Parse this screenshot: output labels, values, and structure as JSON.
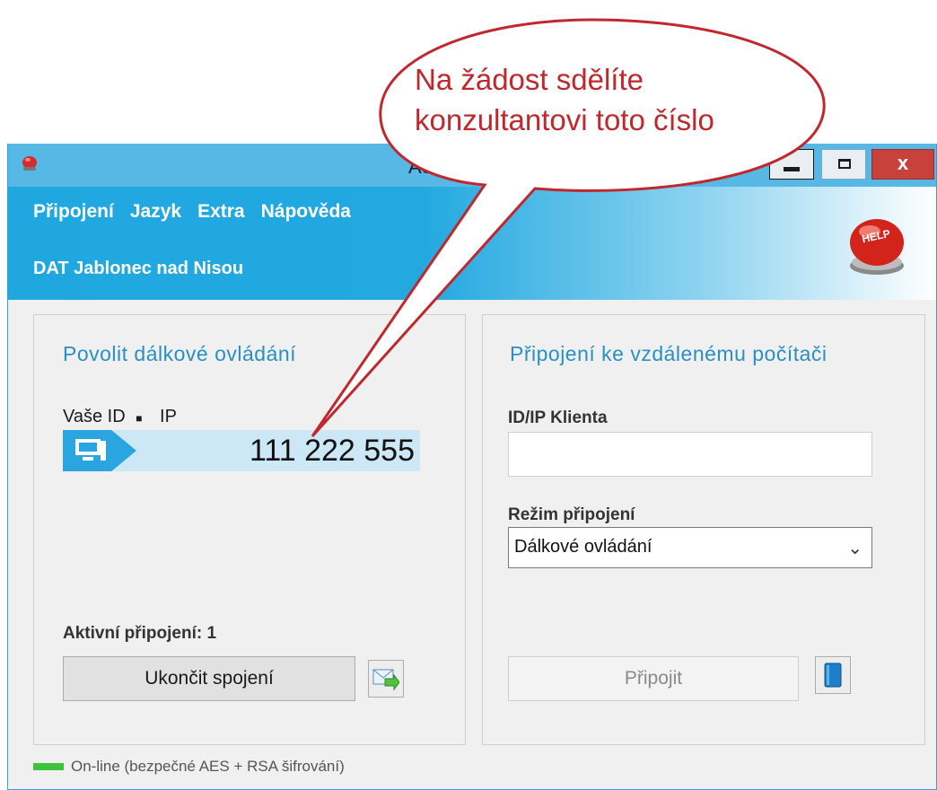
{
  "window": {
    "title": "Aero"
  },
  "titlebar": {
    "close_label": "x"
  },
  "menu": {
    "items": [
      "Připojení",
      "Jazyk",
      "Extra",
      "Nápověda"
    ]
  },
  "organization": "DAT Jablonec nad Nisou",
  "help_badge": "HELP",
  "left_panel": {
    "title": "Povolit dálkové ovládání",
    "id_label": "Vaše ID",
    "ip_label": "IP",
    "id_value": "111 222 555",
    "active_connections": "Aktivní připojení: 1",
    "end_button": "Ukončit spojení"
  },
  "right_panel": {
    "title": "Připojení ke vzdálenému počítači",
    "client_label": "ID/IP Klienta",
    "client_value": "",
    "mode_label": "Režim připojení",
    "mode_selected": "Dálkové ovládání",
    "connect_button": "Připojit"
  },
  "status": {
    "text": "On-line (bezpečné AES + RSA šifrování)",
    "color": "#3dc43d"
  },
  "callout": {
    "line1": "Na žádost sdělíte",
    "line2": "konzultantovi toto číslo",
    "color": "#c0282d"
  }
}
